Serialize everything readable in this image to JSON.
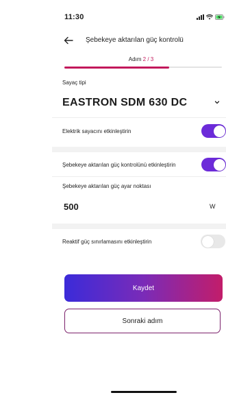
{
  "status_bar": {
    "time": "11:30"
  },
  "header": {
    "title": "Şebekeye aktarılan güç kontrolü",
    "back_icon": "arrow-left-icon"
  },
  "steps": {
    "prefix": "Adım",
    "current": "2 / 3",
    "progress_fraction": 0.667
  },
  "meter": {
    "label": "Sayaç tipi",
    "selected": "EASTRON SDM 630 DC"
  },
  "settings": {
    "meter_toggle": {
      "label": "Elektrik sayacını etkinleştirin",
      "enabled": true
    },
    "grid_control_toggle": {
      "label": "Şebekeye aktarılan güç kontrolünü etkinleştirin",
      "enabled": true
    },
    "setpoint": {
      "label": "Şebekeye aktarılan güç ayar noktası",
      "value": "500",
      "unit": "W"
    },
    "reactive_toggle": {
      "label": "Reaktif güç sınırlamasını etkinleştirin",
      "enabled": false
    }
  },
  "buttons": {
    "save": "Kaydet",
    "next": "Sonraki adım"
  },
  "colors": {
    "accent": "#c2185b",
    "toggle_on": "#6c2bd9",
    "gradient_start": "#3b2bd9",
    "gradient_end": "#c21d6a"
  }
}
